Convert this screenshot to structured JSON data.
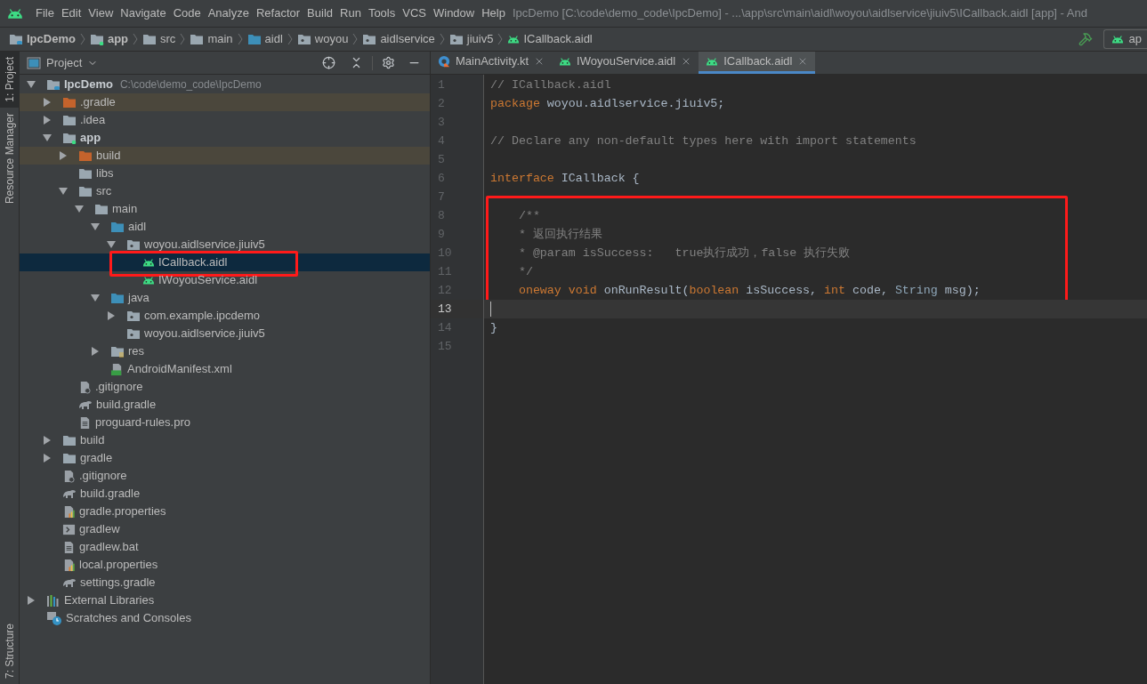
{
  "menu": {
    "items": [
      "File",
      "Edit",
      "View",
      "Navigate",
      "Code",
      "Analyze",
      "Refactor",
      "Build",
      "Run",
      "Tools",
      "VCS",
      "Window",
      "Help"
    ],
    "title": "IpcDemo [C:\\code\\demo_code\\IpcDemo] - ...\\app\\src\\main\\aidl\\woyou\\aidlservice\\jiuiv5\\ICallback.aidl [app] - And"
  },
  "breadcrumb": [
    {
      "label": "IpcDemo",
      "kind": "project"
    },
    {
      "label": "app",
      "kind": "module"
    },
    {
      "label": "src",
      "kind": "folder"
    },
    {
      "label": "main",
      "kind": "folder"
    },
    {
      "label": "aidl",
      "kind": "source"
    },
    {
      "label": "woyou",
      "kind": "package"
    },
    {
      "label": "aidlservice",
      "kind": "package"
    },
    {
      "label": "jiuiv5",
      "kind": "package"
    },
    {
      "label": "ICallback.aidl",
      "kind": "android"
    }
  ],
  "run_config": {
    "label": "ap"
  },
  "side_tabs": [
    {
      "label": "1: Project",
      "selected": true
    },
    {
      "label": "Resource Manager",
      "selected": false
    },
    {
      "label": "7: Structure",
      "selected": false
    }
  ],
  "project_panel": {
    "title": "Project",
    "tree": [
      {
        "label": "IpcDemo",
        "path": "C:\\code\\demo_code\\IpcDemo",
        "kind": "project",
        "expanded": true,
        "selected": false,
        "excluded": false,
        "children": [
          {
            "label": ".gradle",
            "kind": "folder",
            "expanded": false,
            "selected": false,
            "excluded": true
          },
          {
            "label": ".idea",
            "kind": "folder",
            "expanded": false,
            "selected": false,
            "excluded": false
          },
          {
            "label": "app",
            "kind": "module",
            "expanded": true,
            "selected": false,
            "excluded": false,
            "children": [
              {
                "label": "build",
                "kind": "folder",
                "expanded": false,
                "selected": false,
                "excluded": true
              },
              {
                "label": "libs",
                "kind": "folder",
                "selected": false,
                "excluded": false
              },
              {
                "label": "src",
                "kind": "folder",
                "expanded": true,
                "selected": false,
                "excluded": false,
                "children": [
                  {
                    "label": "main",
                    "kind": "folder",
                    "expanded": true,
                    "selected": false,
                    "excluded": false,
                    "children": [
                      {
                        "label": "aidl",
                        "kind": "source",
                        "expanded": true,
                        "selected": false,
                        "excluded": false,
                        "children": [
                          {
                            "label": "woyou.aidlservice.jiuiv5",
                            "kind": "package",
                            "expanded": true,
                            "selected": false,
                            "excluded": false,
                            "children": [
                              {
                                "label": "ICallback.aidl",
                                "kind": "android",
                                "selected": true,
                                "excluded": false,
                                "annotated": true
                              },
                              {
                                "label": "IWoyouService.aidl",
                                "kind": "android",
                                "selected": false,
                                "excluded": false
                              }
                            ]
                          }
                        ]
                      },
                      {
                        "label": "java",
                        "kind": "source",
                        "expanded": true,
                        "selected": false,
                        "excluded": false,
                        "children": [
                          {
                            "label": "com.example.ipcdemo",
                            "kind": "package",
                            "expanded": false,
                            "selected": false,
                            "excluded": false
                          },
                          {
                            "label": "woyou.aidlservice.jiuiv5",
                            "kind": "package",
                            "selected": false,
                            "excluded": false
                          }
                        ]
                      },
                      {
                        "label": "res",
                        "kind": "resource",
                        "expanded": false,
                        "selected": false,
                        "excluded": false
                      },
                      {
                        "label": "AndroidManifest.xml",
                        "kind": "manifest",
                        "selected": false,
                        "excluded": false
                      }
                    ]
                  }
                ]
              },
              {
                "label": ".gitignore",
                "kind": "ignore",
                "selected": false,
                "excluded": false
              },
              {
                "label": "build.gradle",
                "kind": "gradle",
                "selected": false,
                "excluded": false
              },
              {
                "label": "proguard-rules.pro",
                "kind": "text",
                "selected": false,
                "excluded": false
              }
            ]
          },
          {
            "label": "build",
            "kind": "folder",
            "expanded": false,
            "selected": false,
            "excluded": false
          },
          {
            "label": "gradle",
            "kind": "folder",
            "expanded": false,
            "selected": false,
            "excluded": false
          },
          {
            "label": ".gitignore",
            "kind": "ignore",
            "selected": false,
            "excluded": false
          },
          {
            "label": "build.gradle",
            "kind": "gradle",
            "selected": false,
            "excluded": false
          },
          {
            "label": "gradle.properties",
            "kind": "properties",
            "selected": false,
            "excluded": false
          },
          {
            "label": "gradlew",
            "kind": "shell",
            "selected": false,
            "excluded": false
          },
          {
            "label": "gradlew.bat",
            "kind": "text",
            "selected": false,
            "excluded": false
          },
          {
            "label": "local.properties",
            "kind": "properties",
            "selected": false,
            "excluded": false
          },
          {
            "label": "settings.gradle",
            "kind": "gradle",
            "selected": false,
            "excluded": false
          }
        ]
      },
      {
        "label": "External Libraries",
        "kind": "libraries",
        "expanded": false,
        "selected": false,
        "excluded": false
      },
      {
        "label": "Scratches and Consoles",
        "kind": "scratches",
        "selected": false,
        "excluded": false
      }
    ]
  },
  "editor_tabs": [
    {
      "label": "MainActivity.kt",
      "kind": "kotlin",
      "selected": false
    },
    {
      "label": "IWoyouService.aidl",
      "kind": "android",
      "selected": false
    },
    {
      "label": "ICallback.aidl",
      "kind": "android",
      "selected": true
    }
  ],
  "editor": {
    "blocks": [
      {
        "annotated": false,
        "lines": [
          {
            "number": "1",
            "current": false,
            "tokens": [
              {
                "text": "// ICallback.aidl",
                "kind": "comment"
              }
            ]
          },
          {
            "number": "2",
            "current": false,
            "tokens": [
              {
                "text": "package",
                "kind": "keyword"
              },
              {
                "text": " woyou.aidlservice.jiuiv5;",
                "kind": "plain"
              }
            ]
          },
          {
            "number": "3",
            "current": false
          },
          {
            "number": "4",
            "current": false,
            "tokens": [
              {
                "text": "// Declare any non-default types here with import statements",
                "kind": "comment"
              }
            ]
          },
          {
            "number": "5",
            "current": false
          },
          {
            "number": "6",
            "current": false,
            "tokens": [
              {
                "text": "interface",
                "kind": "keyword"
              },
              {
                "text": " ICallback {",
                "kind": "plain"
              }
            ]
          },
          {
            "number": "7",
            "current": false
          }
        ]
      },
      {
        "annotated": true,
        "lines": [
          {
            "number": "8",
            "current": false,
            "tokens": [
              {
                "text": "    /**",
                "kind": "comment"
              }
            ]
          },
          {
            "number": "9",
            "current": false,
            "tokens": [
              {
                "text": "    * 返回执行结果",
                "kind": "comment"
              }
            ]
          },
          {
            "number": "10",
            "current": false,
            "tokens": [
              {
                "text": "    * @param isSuccess:   true执行成功，false 执行失败",
                "kind": "comment"
              }
            ]
          },
          {
            "number": "11",
            "current": false,
            "tokens": [
              {
                "text": "    */",
                "kind": "comment"
              }
            ]
          },
          {
            "number": "12",
            "current": false,
            "tokens": [
              {
                "text": "    oneway void",
                "kind": "keyword"
              },
              {
                "text": " onRunResult(",
                "kind": "plain"
              },
              {
                "text": "boolean",
                "kind": "keyword"
              },
              {
                "text": " isSuccess, ",
                "kind": "plain"
              },
              {
                "text": "int",
                "kind": "keyword"
              },
              {
                "text": " code, ",
                "kind": "plain"
              },
              {
                "text": "String",
                "kind": "type"
              },
              {
                "text": " msg);",
                "kind": "plain"
              }
            ]
          }
        ]
      },
      {
        "annotated": false,
        "lines": [
          {
            "number": "13",
            "current": true
          },
          {
            "number": "14",
            "current": false,
            "tokens": [
              {
                "text": "}",
                "kind": "plain"
              }
            ]
          },
          {
            "number": "15",
            "current": false
          }
        ]
      }
    ]
  }
}
